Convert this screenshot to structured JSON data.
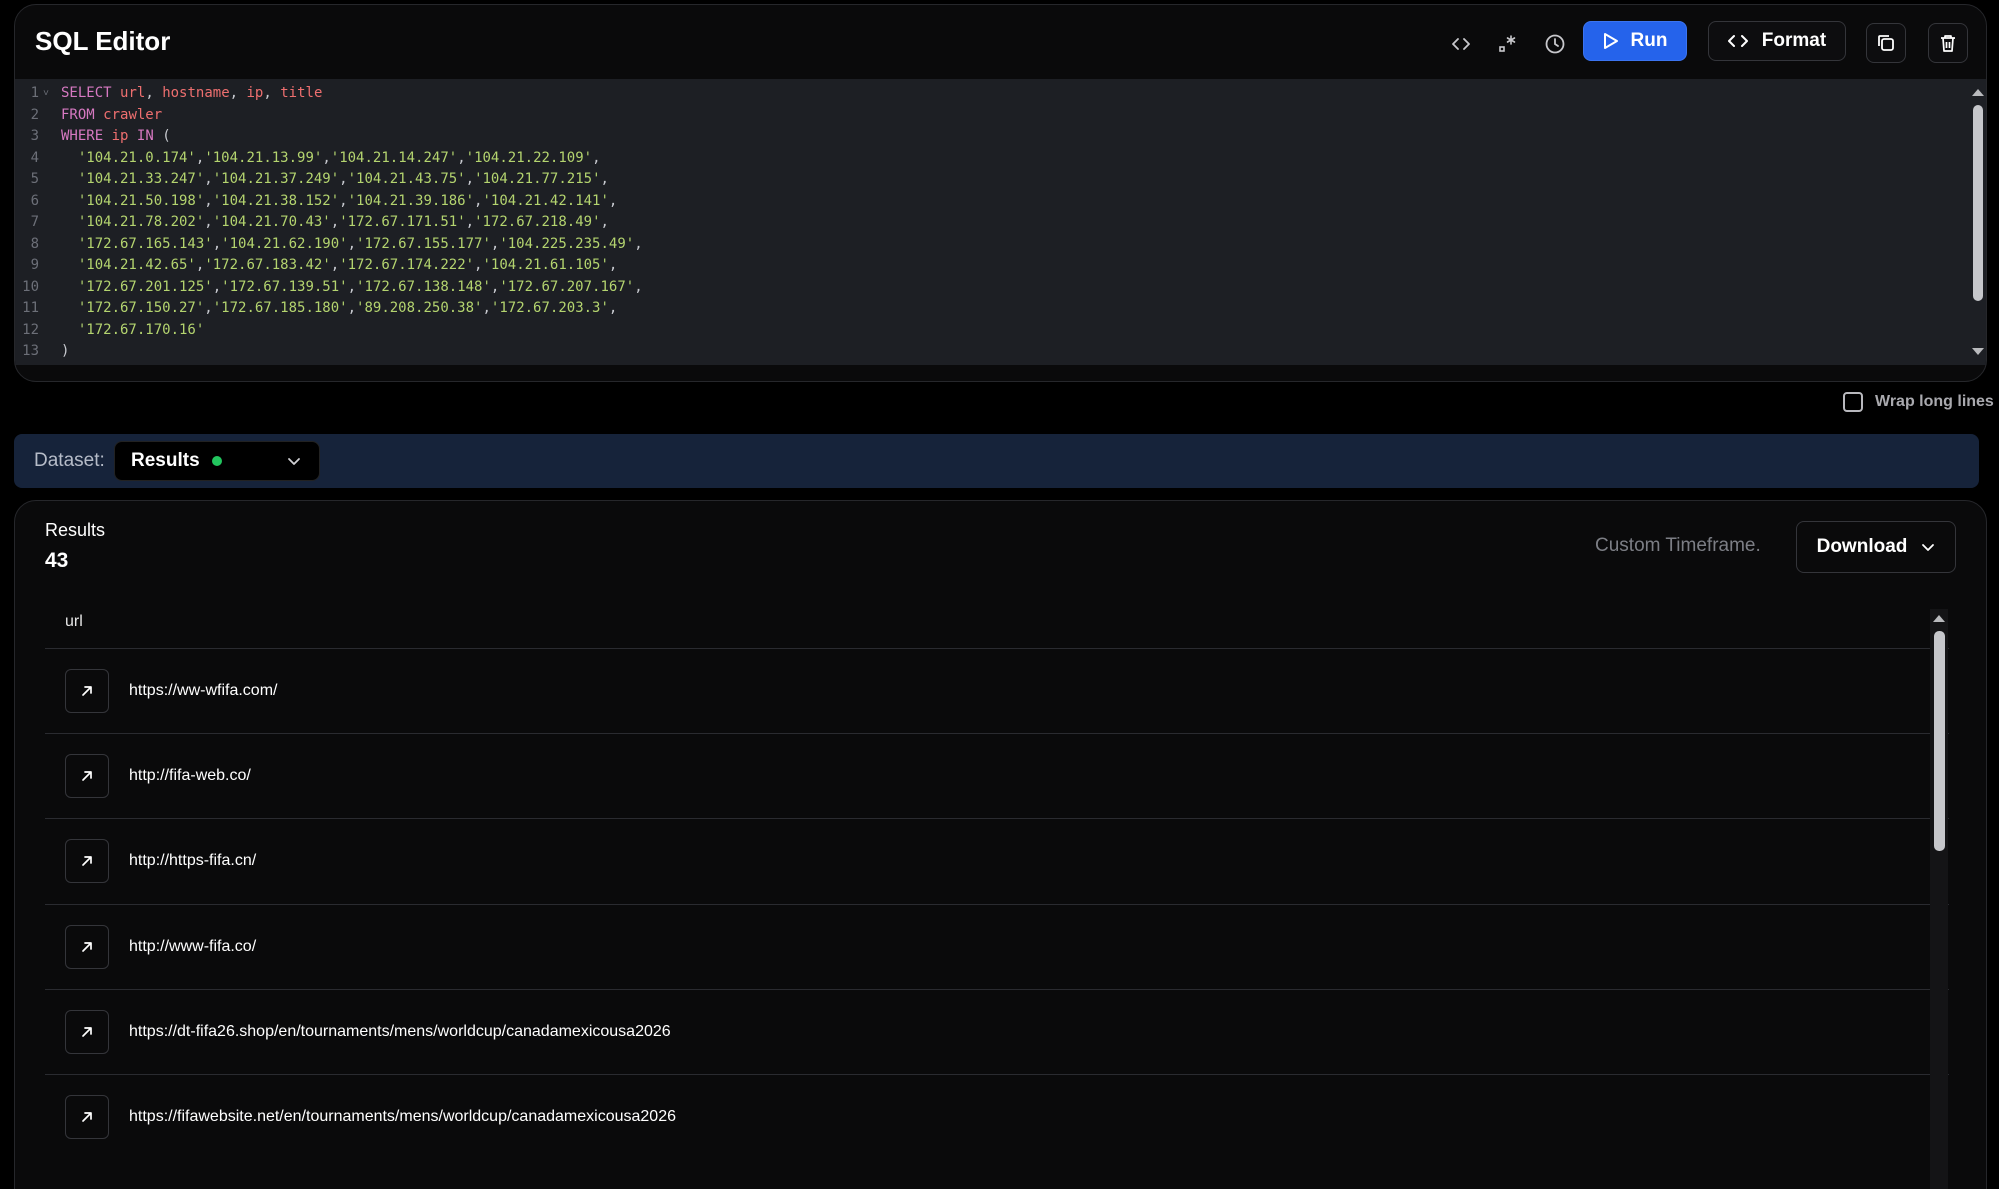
{
  "editor": {
    "title": "SQL Editor",
    "toolbar": {
      "embed_icon": "code-brackets-icon",
      "regex_icon": "regex-icon",
      "history_icon": "history-clock-icon",
      "run_label": "Run",
      "format_label": "Format",
      "copy_icon": "copy-icon",
      "delete_icon": "trash-icon"
    },
    "code_lines": [
      {
        "n": "1",
        "t": "SELECT url, hostname, ip, title"
      },
      {
        "n": "2",
        "t": "FROM crawler"
      },
      {
        "n": "3",
        "t": "WHERE ip IN ("
      },
      {
        "n": "4",
        "t": "  '104.21.0.174','104.21.13.99','104.21.14.247','104.21.22.109',"
      },
      {
        "n": "5",
        "t": "  '104.21.33.247','104.21.37.249','104.21.43.75','104.21.77.215',"
      },
      {
        "n": "6",
        "t": "  '104.21.50.198','104.21.38.152','104.21.39.186','104.21.42.141',"
      },
      {
        "n": "7",
        "t": "  '104.21.78.202','104.21.70.43','172.67.171.51','172.67.218.49',"
      },
      {
        "n": "8",
        "t": "  '172.67.165.143','104.21.62.190','172.67.155.177','104.225.235.49',"
      },
      {
        "n": "9",
        "t": "  '104.21.42.65','172.67.183.42','172.67.174.222','104.21.61.105',"
      },
      {
        "n": "10",
        "t": "  '172.67.201.125','172.67.139.51','172.67.138.148','172.67.207.167',"
      },
      {
        "n": "11",
        "t": "  '172.67.150.27','172.67.185.180','89.208.250.38','172.67.203.3',"
      },
      {
        "n": "12",
        "t": "  '172.67.170.16'"
      },
      {
        "n": "13",
        "t": ")"
      }
    ],
    "wrap_label": "Wrap long lines",
    "wrap_checked": false
  },
  "dataset": {
    "label": "Dataset:",
    "selected": "Results",
    "status_color": "#22c55e"
  },
  "results": {
    "label": "Results",
    "count": "43",
    "timeframe": "Custom Timeframe.",
    "download_label": "Download",
    "column_header": "url",
    "rows": [
      "https://ww-wfifa.com/",
      "http://fifa-web.co/",
      "http://https-fifa.cn/",
      "http://www-fifa.co/",
      "https://dt-fifa26.shop/en/tournaments/mens/worldcup/canadamexicousa2026",
      "https://fifawebsite.net/en/tournaments/mens/worldcup/canadamexicousa2026"
    ]
  },
  "colors": {
    "accent": "#2563eb",
    "keyword": "#d779c2",
    "identifier": "#ee6f6f",
    "string": "#b4d46f"
  }
}
